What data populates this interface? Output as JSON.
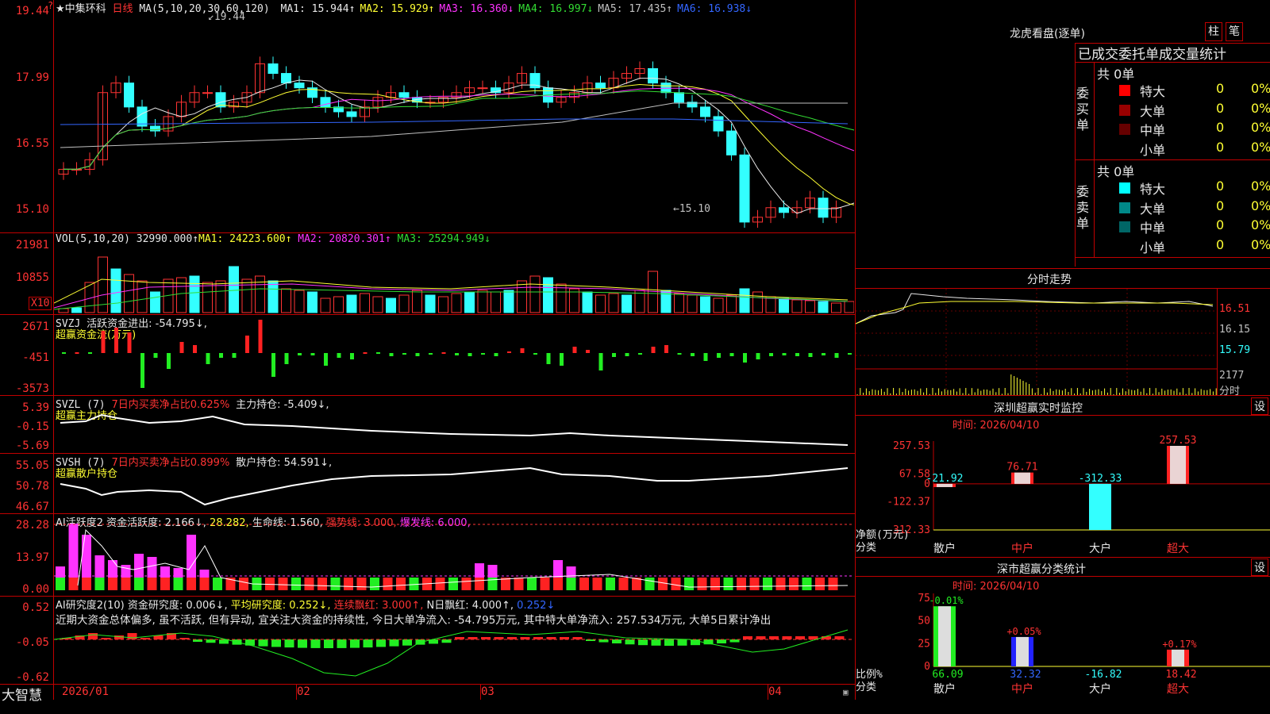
{
  "main_chart": {
    "stock_name": "★中集环科",
    "period": "日线",
    "ma_label": "MA(5,10,20,30,60,120)",
    "ma_values": [
      {
        "name": "MA1:",
        "value": "15.944↑",
        "color": "#e8e8e8"
      },
      {
        "name": "MA2:",
        "value": "15.929↑",
        "color": "#ffff33"
      },
      {
        "name": "MA3:",
        "value": "16.360↓",
        "color": "#ff33ff"
      },
      {
        "name": "MA4:",
        "value": "16.997↓",
        "color": "#33dd33"
      },
      {
        "name": "MA5:",
        "value": "17.435↑",
        "color": "#c0c0c0"
      },
      {
        "name": "MA6:",
        "value": "16.938↓",
        "color": "#3366ff"
      }
    ],
    "y_ticks": [
      "19.44",
      "17.99",
      "16.55",
      "15.10"
    ],
    "high_marker": "19.44",
    "low_marker": "15.10",
    "top_tick": "19.44"
  },
  "vol_panel": {
    "label": "VOL(5,10,20)",
    "value": "32990.000↑",
    "ma1": "MA1: 24223.600↑",
    "ma2": "MA2: 20820.301↑",
    "ma3": "MA3: 25294.949↓",
    "y_ticks": [
      "21981",
      "10855"
    ],
    "unit": "X10"
  },
  "svzj_panel": {
    "label": "SVZJ",
    "desc": "活跃资金进出: -54.795↓,",
    "sub": "超赢资金流(万元)",
    "y_ticks": [
      "2671",
      "-451",
      "-3573"
    ]
  },
  "svzl_panel": {
    "label": "SVZL (7)",
    "desc1": "7日内买卖净占比0.625%",
    "desc2": "主力持仓: -5.409↓,",
    "sub": "超赢主力持仓",
    "y_ticks": [
      "5.39",
      "-0.15",
      "-5.69"
    ]
  },
  "svsh_panel": {
    "label": "SVSH (7)",
    "desc1": "7日内买卖净占比0.899%",
    "desc2": "散户持仓: 54.591↓,",
    "sub": "超赢散户持仓",
    "y_ticks": [
      "55.05",
      "50.78",
      "46.67"
    ]
  },
  "ai_active": {
    "label": "AI活跃度2",
    "desc1": "资金活跃度: 2.166↓,",
    "desc2": "28.282,",
    "desc3": "生命线: 1.560,",
    "desc4": "强势线: 3.000,",
    "desc5": "爆发线: 6.000,",
    "y_ticks": [
      "28.28",
      "13.97",
      "0.00"
    ]
  },
  "ai_research": {
    "label": "AI研究度2(10)",
    "desc1": "资金研究度: 0.006↓,",
    "desc2": "平均研究度: 0.252↓,",
    "desc3": "连续飘红: 3.000↑,",
    "desc4": "N日飘红: 4.000↑,",
    "desc5": "0.252↓",
    "comment": "近期大资金总体偏多, 虽不活跃, 但有异动, 宜关注大资金的持续性, 今日大单净流入: -54.795万元, 其中特大单净流入: 257.534万元, 大单5日累计净出",
    "y_ticks": [
      "0.52",
      "-0.05",
      "-0.62"
    ]
  },
  "x_axis": {
    "labels": [
      "2026/01",
      "02",
      "03",
      "04"
    ]
  },
  "footer": {
    "brand": "大智慧"
  },
  "dragon_tiger": {
    "title": "龙虎看盘(逐单)",
    "btn_bar": "柱",
    "btn_pen": "笔",
    "subtitle": "已成交委托单成交量统计",
    "buy_group": {
      "side_label": "委买单",
      "total": "共 0单",
      "rows": [
        {
          "label": "特大",
          "count": "0",
          "pct": "0%",
          "color": "#ff0000"
        },
        {
          "label": "大单",
          "count": "0",
          "pct": "0%",
          "color": "#990000"
        },
        {
          "label": "中单",
          "count": "0",
          "pct": "0%",
          "color": "#660000"
        },
        {
          "label": "小单",
          "count": "0",
          "pct": "0%",
          "color": "#000000"
        }
      ]
    },
    "sell_group": {
      "side_label": "委卖单",
      "total": "共 0单",
      "rows": [
        {
          "label": "特大",
          "count": "0",
          "pct": "0%",
          "color": "#00ffff"
        },
        {
          "label": "大单",
          "count": "0",
          "pct": "0%",
          "color": "#008888"
        },
        {
          "label": "中单",
          "count": "0",
          "pct": "0%",
          "color": "#006666"
        },
        {
          "label": "小单",
          "count": "0",
          "pct": "0%",
          "color": "#000000"
        }
      ]
    }
  },
  "intraday": {
    "title": "分时走势",
    "y_ticks": [
      "16.51",
      "16.15",
      "15.79"
    ],
    "vol_tick": "2177",
    "vol_label": "分时"
  },
  "sz_monitor": {
    "title": "深圳超赢实时监控",
    "btn": "设",
    "time": "时间: 2026/04/10",
    "y_ticks": [
      "257.53",
      "67.58",
      "0",
      "-122.37",
      "-312.33"
    ],
    "y_label": "净额(万元)",
    "x_label": "分类",
    "categories": [
      "散户",
      "中户",
      "大户",
      "超大"
    ],
    "values": [
      -21.92,
      76.71,
      -312.33,
      257.53
    ],
    "value_labels": [
      "-21.92",
      "76.71",
      "-312.33",
      "257.53"
    ]
  },
  "sz_class": {
    "title": "深市超赢分类统计",
    "btn": "设",
    "time": "时间: 2026/04/10",
    "y_ticks": [
      "75",
      "50",
      "25",
      "0"
    ],
    "y_label": "比例%",
    "x_label": "分类",
    "categories": [
      "散户",
      "中户",
      "大户",
      "超大"
    ],
    "values": [
      66.09,
      32.32,
      -16.82,
      18.42
    ],
    "changes": [
      "-0.01%",
      "+0.05%",
      "",
      "+0.17%"
    ]
  },
  "chart_data": [
    {
      "type": "bar",
      "title": "深圳超赢实时监控",
      "ylabel": "净额(万元)",
      "categories": [
        "散户",
        "中户",
        "大户",
        "超大"
      ],
      "values": [
        -21.92,
        76.71,
        -312.33,
        257.53
      ],
      "ylim": [
        -312.33,
        257.53
      ]
    },
    {
      "type": "bar",
      "title": "深市超赢分类统计",
      "ylabel": "比例%",
      "categories": [
        "散户",
        "中户",
        "大户",
        "超大"
      ],
      "values": [
        66.09,
        32.32,
        -16.82,
        18.42
      ],
      "ylim": [
        0,
        75
      ]
    }
  ]
}
